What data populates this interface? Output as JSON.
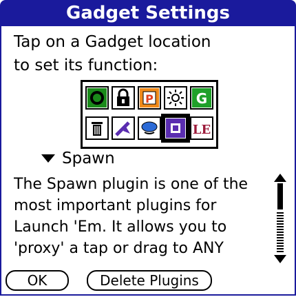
{
  "window": {
    "title": "Gadget Settings"
  },
  "instructions": {
    "line1": "Tap on a Gadget location",
    "line2": "to set its function:"
  },
  "gadgets": [
    {
      "name": "record-icon"
    },
    {
      "name": "lock-icon"
    },
    {
      "name": "p-icon"
    },
    {
      "name": "brightness-icon"
    },
    {
      "name": "g-icon"
    },
    {
      "name": "trash-icon"
    },
    {
      "name": "wand-icon"
    },
    {
      "name": "speech-bubble-icon"
    },
    {
      "name": "spawn-icon",
      "selected": true
    },
    {
      "name": "le-icon",
      "label": "LE"
    }
  ],
  "plugin_selector": {
    "selected": "Spawn"
  },
  "description": {
    "line1": "The Spawn plugin is one of the",
    "line2": "most important plugins for",
    "line3": "Launch 'Em. It allows you to",
    "line4": "'proxy' a tap or drag to ANY"
  },
  "buttons": {
    "ok": "OK",
    "delete": "Delete Plugins"
  },
  "colors": {
    "title_bg": "#1a1a9c",
    "accent_purple": "#5a2db0",
    "accent_orange": "#f08a1a",
    "accent_green": "#1fa02a"
  }
}
